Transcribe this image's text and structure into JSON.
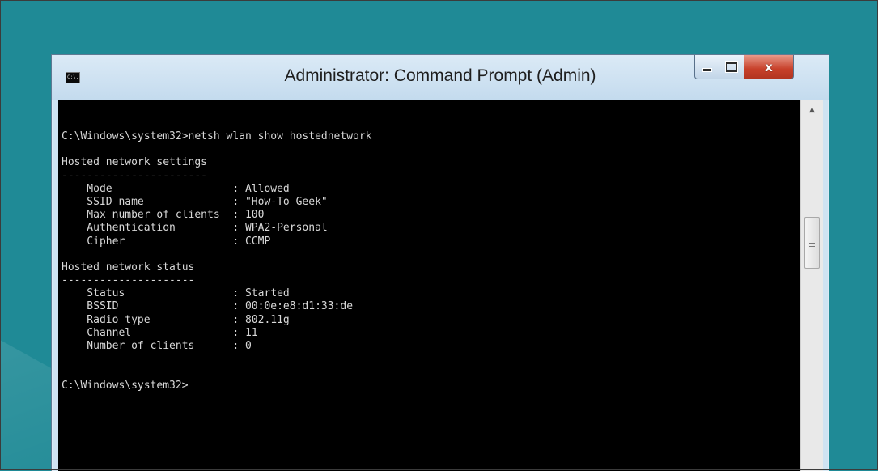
{
  "window": {
    "title": "Administrator: Command Prompt (Admin)",
    "app_icon_text": "C:\\.",
    "controls": {
      "close_label": "x"
    }
  },
  "console": {
    "lines": [
      "C:\\Windows\\system32>netsh wlan show hostednetwork",
      "",
      "Hosted network settings",
      "-----------------------",
      "    Mode                   : Allowed",
      "    SSID name              : \"How-To Geek\"",
      "    Max number of clients  : 100",
      "    Authentication         : WPA2-Personal",
      "    Cipher                 : CCMP",
      "",
      "Hosted network status",
      "---------------------",
      "    Status                 : Started",
      "    BSSID                  : 00:0e:e8:d1:33:de",
      "    Radio type             : 802.11g",
      "    Channel                : 11",
      "    Number of clients      : 0",
      "",
      "",
      "C:\\Windows\\system32>"
    ]
  },
  "colors": {
    "desktop": "#1f8a96",
    "console_bg": "#000000",
    "console_text": "#d8d8d8",
    "close_button": "#c7402a"
  },
  "icons": {
    "minimize": "minimize-icon",
    "maximize": "maximize-icon",
    "close": "close-icon",
    "scroll_up": "scroll-up-arrow-icon",
    "scroll_grip": "scroll-grip-icon"
  }
}
